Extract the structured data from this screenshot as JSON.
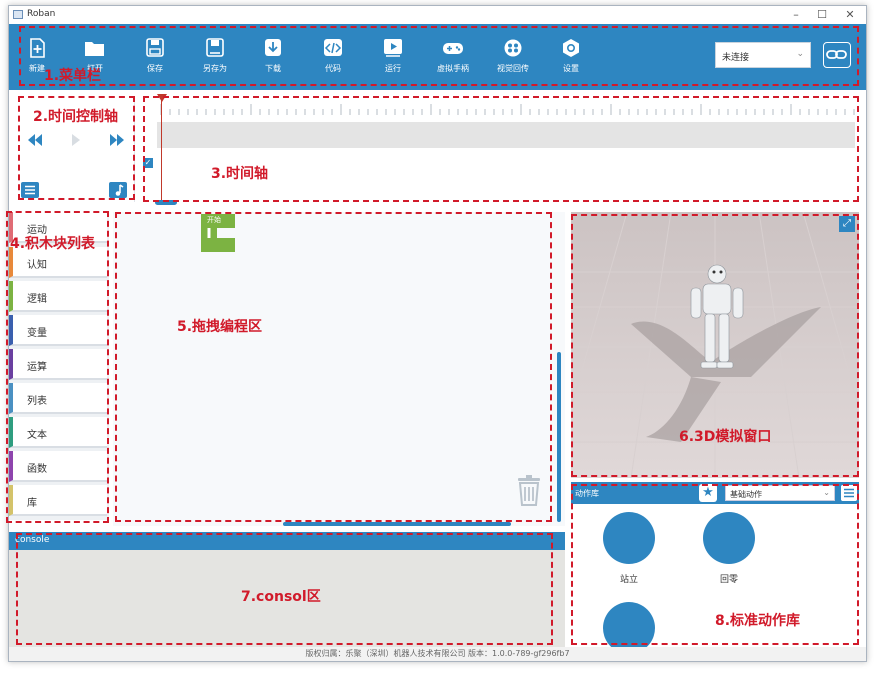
{
  "window": {
    "title": "Roban"
  },
  "toolbar": {
    "buttons": [
      {
        "label": "新建",
        "icon": "new-file-icon"
      },
      {
        "label": "打开",
        "icon": "folder-open-icon"
      },
      {
        "label": "保存",
        "icon": "save-icon"
      },
      {
        "label": "另存为",
        "icon": "save-as-icon"
      },
      {
        "label": "下载",
        "icon": "download-icon"
      },
      {
        "label": "代码",
        "icon": "code-icon"
      },
      {
        "label": "运行",
        "icon": "play-icon"
      },
      {
        "label": "虚拟手柄",
        "icon": "gamepad-icon"
      },
      {
        "label": "视觉回传",
        "icon": "camera-reel-icon"
      },
      {
        "label": "设置",
        "icon": "settings-icon"
      }
    ],
    "connection": "未连接",
    "link_icon": "link-icon"
  },
  "palette": {
    "items": [
      {
        "label": "运动",
        "color": "#e06c75"
      },
      {
        "label": "认知",
        "color": "#e8893a"
      },
      {
        "label": "逻辑",
        "color": "#7cb342"
      },
      {
        "label": "变量",
        "color": "#3a5fae"
      },
      {
        "label": "运算",
        "color": "#6a3fa0"
      },
      {
        "label": "列表",
        "color": "#4a90c2"
      },
      {
        "label": "文本",
        "color": "#2e9d7f"
      },
      {
        "label": "函数",
        "color": "#8e44ad"
      },
      {
        "label": "库",
        "color": "#d4c36a"
      }
    ]
  },
  "workspace": {
    "start_block_label": "开始",
    "start_block_color": "#7cb342"
  },
  "action_library": {
    "title": "动作库",
    "category": "基础动作",
    "actions": [
      {
        "label": "站立"
      },
      {
        "label": "回零"
      },
      {
        "label": ""
      }
    ]
  },
  "console": {
    "title": "console"
  },
  "footer": {
    "text": "版权归属：乐聚（深圳）机器人技术有限公司 版本：1.0.0-789-gf296fb7"
  },
  "annotations": [
    {
      "label": "1.菜单栏"
    },
    {
      "label": "2.时间控制轴"
    },
    {
      "label": "3.时间轴"
    },
    {
      "label": "4.积木块列表"
    },
    {
      "label": "5.拖拽编程区"
    },
    {
      "label": "6.3D模拟窗口"
    },
    {
      "label": "7.consol区"
    },
    {
      "label": "8.标准动作库"
    }
  ],
  "colors": {
    "accent": "#2e86c1",
    "annotation": "#d11a2a"
  }
}
